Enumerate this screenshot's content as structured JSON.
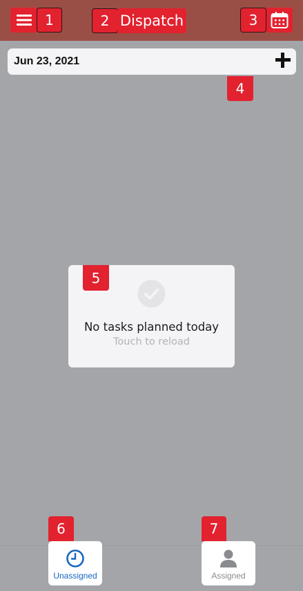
{
  "header": {
    "title": "Dispatch"
  },
  "date_bar": {
    "date": "Jun 23, 2021"
  },
  "empty_state": {
    "title": "No tasks planned today",
    "subtitle": "Touch to reload"
  },
  "bottom_nav": {
    "tabs": [
      {
        "label": "Unassigned",
        "icon": "clock-icon",
        "active": true
      },
      {
        "label": "Assigned",
        "icon": "person-icon",
        "active": false
      }
    ]
  },
  "annotations": [
    "1",
    "2",
    "3",
    "4",
    "5",
    "6",
    "7"
  ],
  "colors": {
    "header": "#9a4f46",
    "accent": "#e2222f",
    "active_tab": "#1565c0",
    "background": "#a4a5a9"
  }
}
